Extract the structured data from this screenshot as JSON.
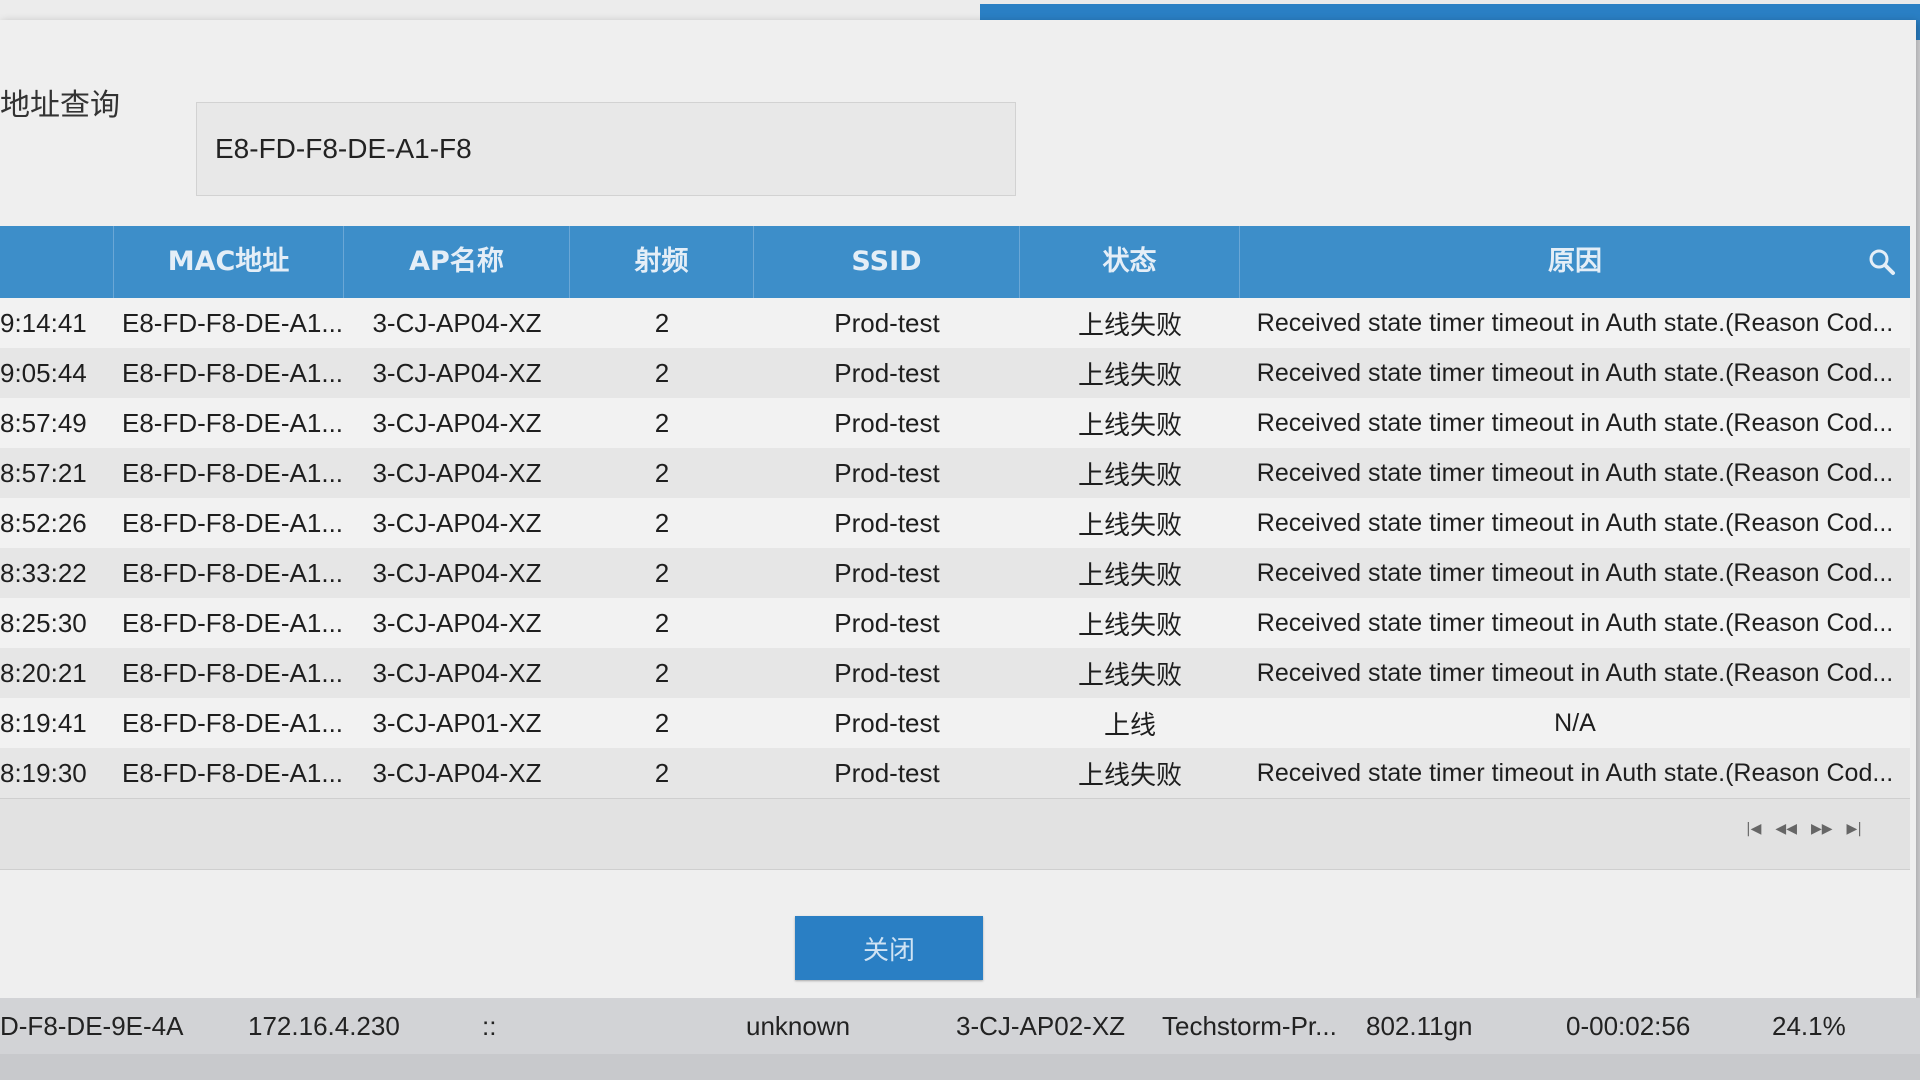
{
  "dialog": {
    "search_label": "地址查询",
    "search_value": "E8-FD-F8-DE-A1-F8",
    "close_label": "关闭"
  },
  "table": {
    "columns": [
      "",
      "MAC地址",
      "AP名称",
      "射频",
      "SSID",
      "状态",
      "原因"
    ],
    "rows": [
      [
        "9:14:41",
        "E8-FD-F8-DE-A1...",
        "3-CJ-AP04-XZ",
        "2",
        "Prod-test",
        "上线失败",
        "Received state timer timeout in Auth state.(Reason Cod..."
      ],
      [
        "9:05:44",
        "E8-FD-F8-DE-A1...",
        "3-CJ-AP04-XZ",
        "2",
        "Prod-test",
        "上线失败",
        "Received state timer timeout in Auth state.(Reason Cod..."
      ],
      [
        "8:57:49",
        "E8-FD-F8-DE-A1...",
        "3-CJ-AP04-XZ",
        "2",
        "Prod-test",
        "上线失败",
        "Received state timer timeout in Auth state.(Reason Cod..."
      ],
      [
        "8:57:21",
        "E8-FD-F8-DE-A1...",
        "3-CJ-AP04-XZ",
        "2",
        "Prod-test",
        "上线失败",
        "Received state timer timeout in Auth state.(Reason Cod..."
      ],
      [
        "8:52:26",
        "E8-FD-F8-DE-A1...",
        "3-CJ-AP04-XZ",
        "2",
        "Prod-test",
        "上线失败",
        "Received state timer timeout in Auth state.(Reason Cod..."
      ],
      [
        "8:33:22",
        "E8-FD-F8-DE-A1...",
        "3-CJ-AP04-XZ",
        "2",
        "Prod-test",
        "上线失败",
        "Received state timer timeout in Auth state.(Reason Cod..."
      ],
      [
        "8:25:30",
        "E8-FD-F8-DE-A1...",
        "3-CJ-AP04-XZ",
        "2",
        "Prod-test",
        "上线失败",
        "Received state timer timeout in Auth state.(Reason Cod..."
      ],
      [
        "8:20:21",
        "E8-FD-F8-DE-A1...",
        "3-CJ-AP04-XZ",
        "2",
        "Prod-test",
        "上线失败",
        "Received state timer timeout in Auth state.(Reason Cod..."
      ],
      [
        "8:19:41",
        "E8-FD-F8-DE-A1...",
        "3-CJ-AP01-XZ",
        "2",
        "Prod-test",
        "上线",
        "N/A"
      ],
      [
        "8:19:30",
        "E8-FD-F8-DE-A1...",
        "3-CJ-AP04-XZ",
        "2",
        "Prod-test",
        "上线失败",
        "Received state timer timeout in Auth state.(Reason Cod..."
      ]
    ]
  },
  "pager": {
    "first": "|◀",
    "prev": "◀◀",
    "next": "▶▶",
    "last": "▶|"
  },
  "background_row": {
    "mac": "D-F8-DE-9E-4A",
    "ip": "172.16.4.230",
    "ipv6": "::",
    "user": "unknown",
    "ap": "3-CJ-AP02-XZ",
    "ssid": "Techstorm-Pr...",
    "mode": "802.11gn",
    "duration": "0-00:02:56",
    "rate": "24.1%"
  },
  "colors": {
    "header_blue": "#3d8ec9",
    "button_blue": "#2a7fc4"
  }
}
